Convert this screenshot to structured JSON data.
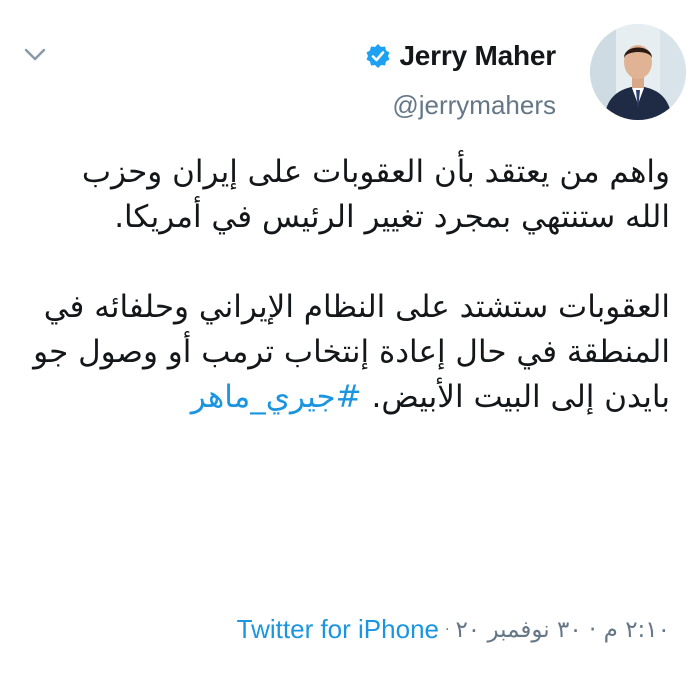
{
  "tweet": {
    "display_name": "Jerry Maher",
    "handle": "@jerrymahers",
    "body_paragraph_1": "واهم من يعتقد بأن العقوبات على إيران وحزب الله ستنتهي بمجرد تغيير الرئيس في أمريكا.",
    "body_paragraph_2_text": "العقوبات ستشتد على النظام الإيراني وحلفائه في المنطقة في حال إعادة إنتخاب ترمب أو وصول جو بايدن إلى البيت الأبيض.",
    "hashtag": "#جيري_ماهر",
    "timestamp": "٢:١٠ م · ٣٠ نوفمبر ٢٠",
    "source": "Twitter for iPhone",
    "separator": "·"
  },
  "icons": {
    "menu": "chevron-down-icon",
    "verified": "verified-badge-icon"
  },
  "colors": {
    "accent": "#1b95e0",
    "verified": "#1da1f2",
    "secondary_text": "#657786",
    "primary_text": "#14171a"
  }
}
